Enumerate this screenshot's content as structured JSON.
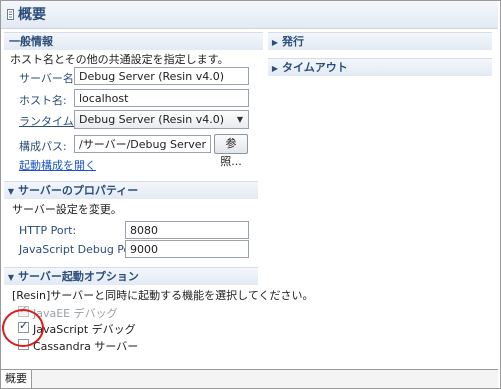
{
  "header": {
    "title": "概要"
  },
  "general": {
    "title": "一般情報",
    "description": "ホスト名とその他の共通設定を指定します。",
    "server_name_label": "サーバー名:",
    "server_name_value": "Debug Server (Resin v4.0)",
    "host_name_label": "ホスト名:",
    "host_name_value": "localhost",
    "runtime_label": "ランタイム:",
    "runtime_value": "Debug Server (Resin v4.0)",
    "config_path_label": "構成パス:",
    "config_path_value": "/サーバー/Debug Server (Resin",
    "browse_label": "参照...",
    "open_launch_config": "起動構成を開く"
  },
  "publish": {
    "title": "発行"
  },
  "timeout": {
    "title": "タイムアウト"
  },
  "server_props": {
    "title": "サーバーのプロパティー",
    "description": "サーバー設定を変更。",
    "http_port_label": "HTTP Port:",
    "http_port_value": "8080",
    "js_debug_port_label": "JavaScript Debug Port:",
    "js_debug_port_value": "9000"
  },
  "startup": {
    "title": "サーバー起動オプション",
    "description": "[Resin]サーバーと同時に起動する機能を選択してください。",
    "options": [
      {
        "label": "JavaEE デバッグ",
        "checked": true,
        "disabled": true
      },
      {
        "label": "JavaScript デバッグ",
        "checked": true,
        "disabled": false
      },
      {
        "label": "Cassandra サーバー",
        "checked": false,
        "disabled": false
      }
    ]
  },
  "bottom_tabs": [
    {
      "label": "概要"
    }
  ]
}
